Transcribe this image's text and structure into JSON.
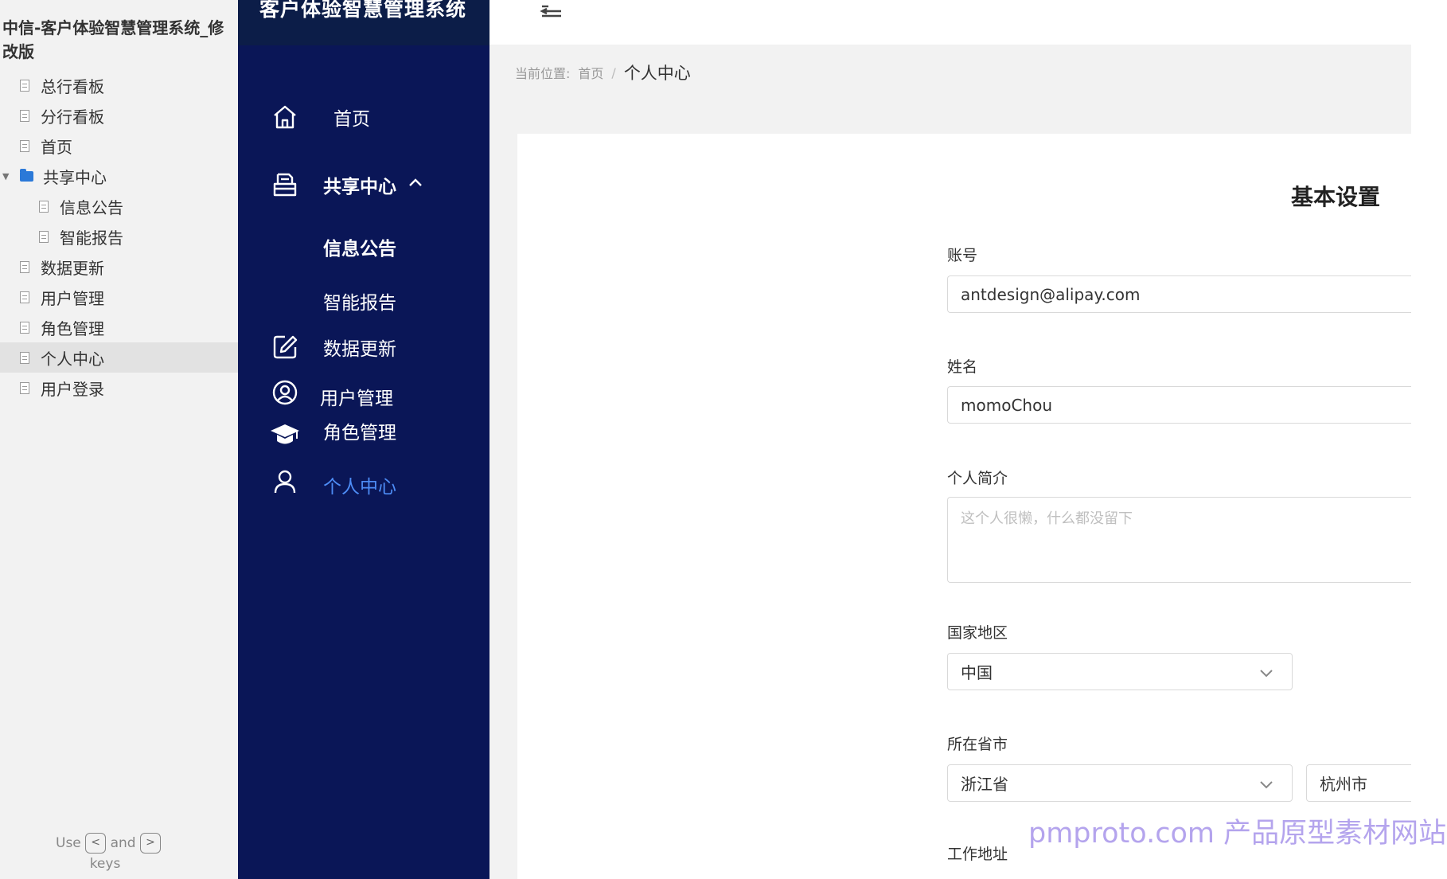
{
  "proto_panel": {
    "title": "中信-客户体验智慧管理系统_修改版",
    "items": [
      {
        "label": "总行看板",
        "type": "page"
      },
      {
        "label": "分行看板",
        "type": "page"
      },
      {
        "label": "首页",
        "type": "page"
      },
      {
        "label": "共享中心",
        "type": "folder",
        "expanded": true
      },
      {
        "label": "信息公告",
        "type": "page",
        "indent": 1
      },
      {
        "label": "智能报告",
        "type": "page",
        "indent": 1
      },
      {
        "label": "数据更新",
        "type": "page"
      },
      {
        "label": "用户管理",
        "type": "page"
      },
      {
        "label": "角色管理",
        "type": "page"
      },
      {
        "label": "个人中心",
        "type": "page",
        "selected": true
      },
      {
        "label": "用户登录",
        "type": "page"
      }
    ],
    "hint": {
      "use": "Use",
      "and": "and",
      "keys": "keys",
      "left_key": "<",
      "right_key": ">"
    }
  },
  "app": {
    "brand": "客户体验智慧管理系统",
    "nav": {
      "home": "首页",
      "share_center": "共享中心",
      "sub_notice": "信息公告",
      "sub_report": "智能报告",
      "data_update": "数据更新",
      "user_mgmt": "用户管理",
      "role_mgmt": "角色管理",
      "personal": "个人中心"
    },
    "colors": {
      "sidebar": "#0a1657",
      "active": "#4d8cf5"
    }
  },
  "breadcrumb": {
    "prefix": "当前位置:",
    "home": "首页",
    "separator": "/",
    "current": "个人中心"
  },
  "form": {
    "title": "基本设置",
    "account_label": "账号",
    "account_value": "antdesign@alipay.com",
    "name_label": "姓名",
    "name_value": "momoChou",
    "bio_label": "个人简介",
    "bio_placeholder": "这个人很懒，什么都没留下",
    "country_label": "国家地区",
    "country_value": "中国",
    "province_label": "所在省市",
    "province_value": "浙江省",
    "city_value": "杭州市",
    "work_address_label": "工作地址"
  },
  "watermark": "pmproto.com 产品原型素材网站"
}
